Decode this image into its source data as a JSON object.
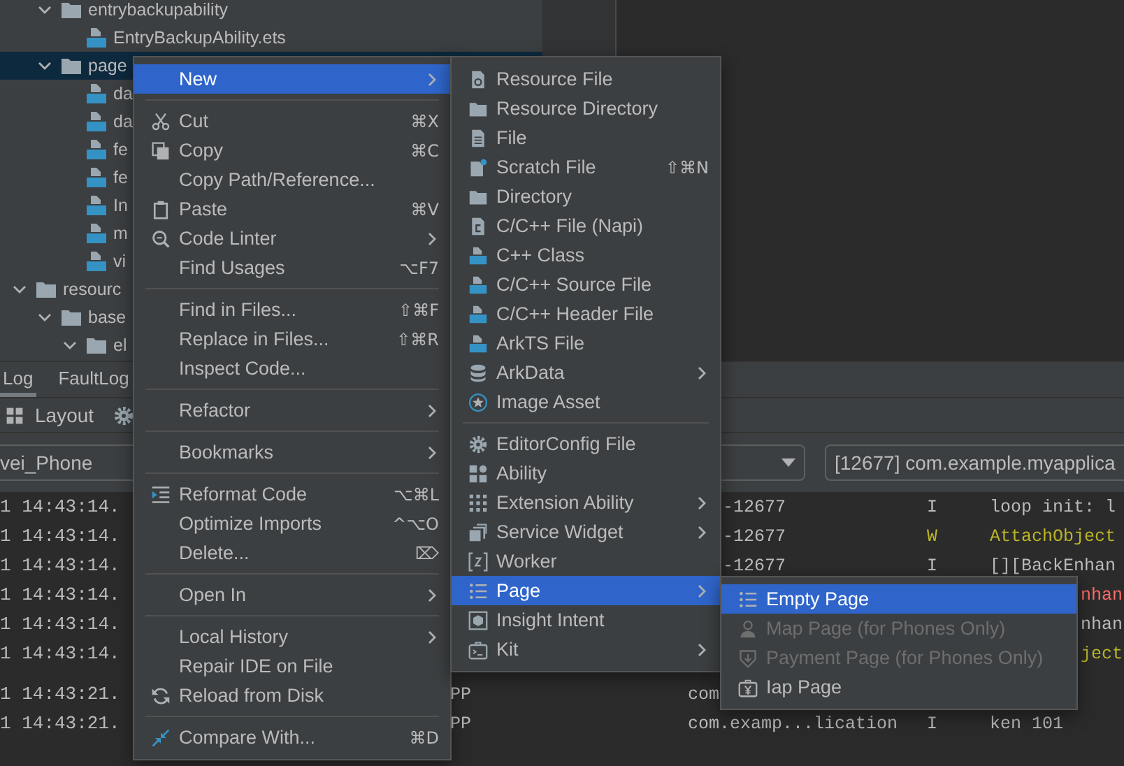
{
  "tree": [
    {
      "kind": "group",
      "children": [
        {
          "kind": "folder",
          "label": "entrybackupability",
          "expanded": true,
          "selected": false,
          "children": [
            {
              "kind": "file",
              "label": "EntryBackupAbility.ets",
              "selected": false
            }
          ]
        },
        {
          "kind": "folder",
          "label": "page",
          "expanded": true,
          "selected": true,
          "children": [
            {
              "kind": "file",
              "label": "da",
              "selected": false
            },
            {
              "kind": "file",
              "label": "da",
              "selected": false
            },
            {
              "kind": "file",
              "label": "fe",
              "selected": false
            },
            {
              "kind": "file",
              "label": "fe",
              "selected": false
            },
            {
              "kind": "file",
              "label": "In",
              "selected": false
            },
            {
              "kind": "file",
              "label": "m",
              "selected": false
            },
            {
              "kind": "file",
              "label": "vi",
              "selected": false
            }
          ]
        }
      ]
    },
    {
      "kind": "folder",
      "label": "resourc",
      "expanded": true,
      "selected": false,
      "children": [
        {
          "kind": "folder",
          "label": "base",
          "expanded": true,
          "selected": false,
          "children": [
            {
              "kind": "folder",
              "label": "el",
              "expanded": true,
              "selected": false
            }
          ]
        }
      ]
    }
  ],
  "bottom_tabs": [
    {
      "label": "Log",
      "selected": true
    },
    {
      "label": "FaultLog",
      "selected": false
    }
  ],
  "toolbar": {
    "layout_button": "Layout"
  },
  "filter": {
    "device": "vei_Phone",
    "process": "[12677] com.example.myapplica"
  },
  "log_rows": [
    {
      "time": "1 14:43:14.",
      "pid_tail": "-12677",
      "level": "I",
      "message": "loop init: l",
      "color": "#bbbbbb"
    },
    {
      "time": "1 14:43:14.",
      "pid_tail": "-12677",
      "level": "W",
      "message": "AttachObject",
      "color": "#bbb529"
    },
    {
      "time": "1 14:43:14.",
      "pid_tail": "-12677",
      "level": "I",
      "message": "[][BackEnhan",
      "color": "#bbbbbb"
    },
    {
      "time": "1 14:43:14.",
      "message_tail": "nhan",
      "color": "#ff6b68"
    },
    {
      "time": "1 14:43:14.",
      "message_tail": "nhan",
      "color": "#bbbbbb"
    },
    {
      "time": "1 14:43:14.",
      "message_tail": "ject",
      "color": "#bbb529"
    },
    {
      "time": "1 14:43:21.",
      "tag": "PP",
      "pid": "com"
    },
    {
      "time": "1 14:43:21.",
      "tag": "PP",
      "pid": "com.examp...lication",
      "level": "I",
      "message": "ken 101",
      "color": "#bbbbbb"
    }
  ],
  "context_menu": {
    "items": [
      {
        "kind": "item",
        "label": "New",
        "submenu": true,
        "selected": true
      },
      {
        "kind": "separator"
      },
      {
        "kind": "item",
        "label": "Cut",
        "shortcut": "⌘X",
        "selected": false
      },
      {
        "kind": "item",
        "label": "Copy",
        "shortcut": "⌘C",
        "selected": false
      },
      {
        "kind": "item",
        "label": "Copy Path/Reference...",
        "selected": false
      },
      {
        "kind": "item",
        "label": "Paste",
        "shortcut": "⌘V",
        "selected": false
      },
      {
        "kind": "item",
        "label": "Code Linter",
        "submenu": true,
        "selected": false
      },
      {
        "kind": "item",
        "label": "Find Usages",
        "shortcut": "⌥F7",
        "selected": false
      },
      {
        "kind": "separator"
      },
      {
        "kind": "item",
        "label": "Find in Files...",
        "shortcut": "⇧⌘F",
        "selected": false
      },
      {
        "kind": "item",
        "label": "Replace in Files...",
        "shortcut": "⇧⌘R",
        "selected": false
      },
      {
        "kind": "item",
        "label": "Inspect Code...",
        "selected": false
      },
      {
        "kind": "separator"
      },
      {
        "kind": "item",
        "label": "Refactor",
        "submenu": true,
        "selected": false
      },
      {
        "kind": "separator"
      },
      {
        "kind": "item",
        "label": "Bookmarks",
        "submenu": true,
        "selected": false
      },
      {
        "kind": "separator"
      },
      {
        "kind": "item",
        "label": "Reformat Code",
        "shortcut": "⌥⌘L",
        "selected": false
      },
      {
        "kind": "item",
        "label": "Optimize Imports",
        "shortcut": "^⌥O",
        "selected": false
      },
      {
        "kind": "item",
        "label": "Delete...",
        "shortcut": "⌦",
        "selected": false
      },
      {
        "kind": "separator"
      },
      {
        "kind": "item",
        "label": "Open In",
        "submenu": true,
        "selected": false
      },
      {
        "kind": "separator"
      },
      {
        "kind": "item",
        "label": "Local History",
        "submenu": true,
        "selected": false
      },
      {
        "kind": "item",
        "label": "Repair IDE on File",
        "selected": false
      },
      {
        "kind": "item",
        "label": "Reload from Disk",
        "selected": false
      },
      {
        "kind": "separator"
      },
      {
        "kind": "item",
        "label": "Compare With...",
        "shortcut": "⌘D",
        "selected": false
      }
    ]
  },
  "new_submenu": {
    "items": [
      {
        "kind": "item",
        "label": "Resource File",
        "selected": false
      },
      {
        "kind": "item",
        "label": "Resource Directory",
        "selected": false
      },
      {
        "kind": "item",
        "label": "File",
        "selected": false
      },
      {
        "kind": "item",
        "label": "Scratch File",
        "shortcut": "⇧⌘N",
        "selected": false
      },
      {
        "kind": "item",
        "label": "Directory",
        "selected": false
      },
      {
        "kind": "item",
        "label": "C/C++ File (Napi)",
        "selected": false
      },
      {
        "kind": "item",
        "label": "C++ Class",
        "selected": false
      },
      {
        "kind": "item",
        "label": "C/C++ Source File",
        "selected": false
      },
      {
        "kind": "item",
        "label": "C/C++ Header File",
        "selected": false
      },
      {
        "kind": "item",
        "label": "ArkTS File",
        "selected": false
      },
      {
        "kind": "item",
        "label": "ArkData",
        "submenu": true,
        "selected": false
      },
      {
        "kind": "item",
        "label": "Image Asset",
        "selected": false
      },
      {
        "kind": "separator"
      },
      {
        "kind": "item",
        "label": "EditorConfig File",
        "selected": false
      },
      {
        "kind": "item",
        "label": "Ability",
        "selected": false
      },
      {
        "kind": "item",
        "label": "Extension Ability",
        "submenu": true,
        "selected": false
      },
      {
        "kind": "item",
        "label": "Service Widget",
        "submenu": true,
        "selected": false
      },
      {
        "kind": "item",
        "label": "Worker",
        "selected": false
      },
      {
        "kind": "item",
        "label": "Page",
        "submenu": true,
        "selected": true
      },
      {
        "kind": "item",
        "label": "Insight Intent",
        "selected": false
      },
      {
        "kind": "item",
        "label": "Kit",
        "submenu": true,
        "selected": false
      }
    ]
  },
  "page_submenu": {
    "items": [
      {
        "kind": "item",
        "label": "Empty Page",
        "selected": true,
        "disabled": false
      },
      {
        "kind": "item",
        "label": "Map Page (for Phones Only)",
        "selected": false,
        "disabled": true
      },
      {
        "kind": "item",
        "label": "Payment Page (for Phones Only)",
        "selected": false,
        "disabled": true
      },
      {
        "kind": "item",
        "label": "Iap Page",
        "selected": false,
        "disabled": false
      }
    ]
  }
}
